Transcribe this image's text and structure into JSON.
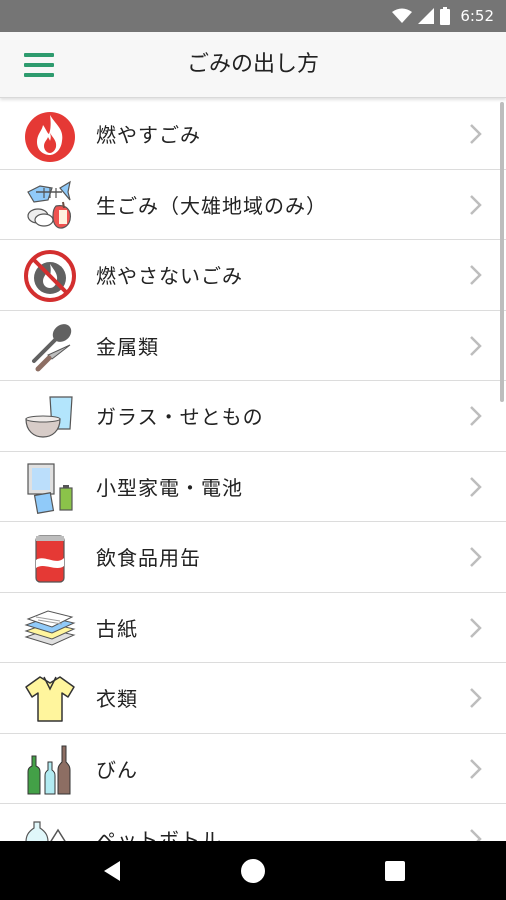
{
  "status": {
    "time": "6:52"
  },
  "header": {
    "title": "ごみの出し方"
  },
  "items": [
    {
      "label": "燃やすごみ",
      "icon": "fire-icon"
    },
    {
      "label": "生ごみ（大雄地域のみ）",
      "icon": "food-waste-icon"
    },
    {
      "label": "燃やさないごみ",
      "icon": "no-burn-icon"
    },
    {
      "label": "金属類",
      "icon": "metal-utensils-icon"
    },
    {
      "label": "ガラス・せともの",
      "icon": "glass-ceramics-icon"
    },
    {
      "label": "小型家電・電池",
      "icon": "small-appliance-battery-icon"
    },
    {
      "label": "飲食品用缶",
      "icon": "can-icon"
    },
    {
      "label": "古紙",
      "icon": "newspaper-icon"
    },
    {
      "label": "衣類",
      "icon": "clothing-icon"
    },
    {
      "label": "びん",
      "icon": "bottles-icon"
    },
    {
      "label": "ペットボトル",
      "icon": "pet-bottle-icon"
    }
  ],
  "colors": {
    "accent": "#2e9b6e",
    "statusbar": "#757575",
    "navbar": "#000000"
  }
}
